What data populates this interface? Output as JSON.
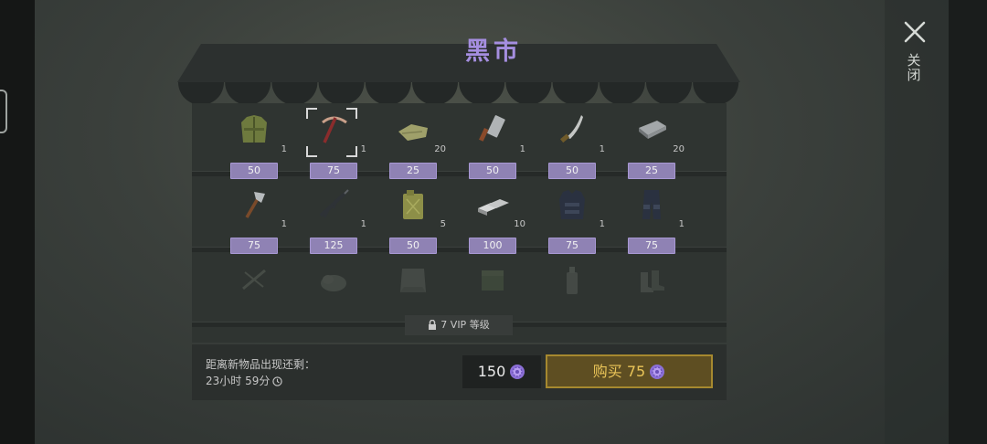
{
  "title": "黑市",
  "close_label": "关闭",
  "shop": {
    "rows": [
      {
        "items": [
          {
            "name": "jacket",
            "qty": "1",
            "price": "50"
          },
          {
            "name": "pickaxe",
            "qty": "1",
            "price": "75",
            "selected": true
          },
          {
            "name": "cloth",
            "qty": "20",
            "price": "25"
          },
          {
            "name": "cleaver",
            "qty": "1",
            "price": "50"
          },
          {
            "name": "machete",
            "qty": "1",
            "price": "50"
          },
          {
            "name": "iron-bar",
            "qty": "20",
            "price": "25"
          }
        ]
      },
      {
        "items": [
          {
            "name": "axe",
            "qty": "1",
            "price": "75"
          },
          {
            "name": "rifle",
            "qty": "1",
            "price": "125"
          },
          {
            "name": "jerrycan",
            "qty": "5",
            "price": "50"
          },
          {
            "name": "steel-bars",
            "qty": "10",
            "price": "100"
          },
          {
            "name": "armor-vest",
            "qty": "1",
            "price": "75"
          },
          {
            "name": "armor-pants",
            "qty": "1",
            "price": "75"
          }
        ]
      },
      {
        "locked": true,
        "items": [
          {
            "name": "crossbow"
          },
          {
            "name": "rocks"
          },
          {
            "name": "panel"
          },
          {
            "name": "ammo-box"
          },
          {
            "name": "bottle"
          },
          {
            "name": "boots"
          }
        ]
      }
    ],
    "lock_text": "7 VIP 等级"
  },
  "footer": {
    "timer_label": "距离新物品出现还剩：",
    "timer_value": "23小时 59分",
    "balance": "150",
    "buy_label": "购买",
    "buy_price": "75"
  },
  "colors": {
    "accent": "#a58ee0",
    "price_bg": "#8f82b4",
    "buy_bg": "#5e4e22",
    "buy_text": "#e9c458"
  }
}
